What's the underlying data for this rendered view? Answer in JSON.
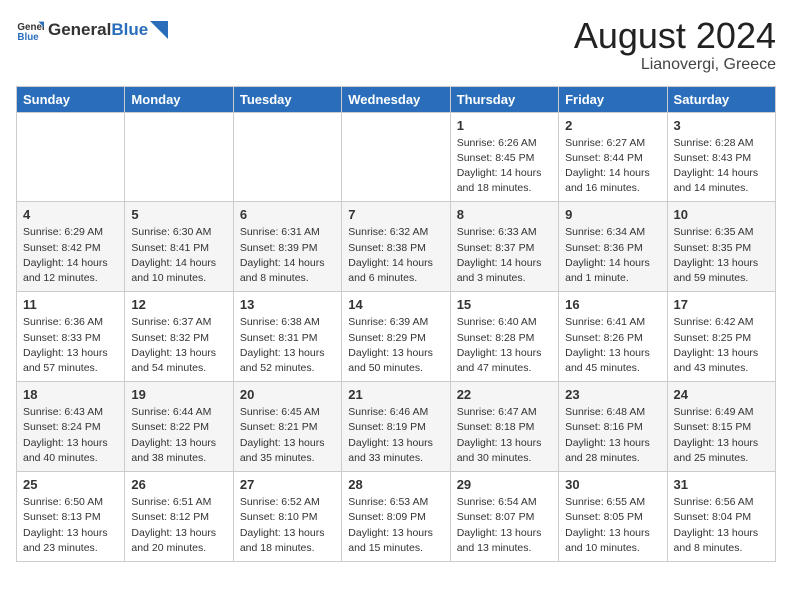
{
  "header": {
    "logo_general": "General",
    "logo_blue": "Blue",
    "month_year": "August 2024",
    "location": "Lianovergi, Greece"
  },
  "weekdays": [
    "Sunday",
    "Monday",
    "Tuesday",
    "Wednesday",
    "Thursday",
    "Friday",
    "Saturday"
  ],
  "weeks": [
    [
      {
        "day": "",
        "content": ""
      },
      {
        "day": "",
        "content": ""
      },
      {
        "day": "",
        "content": ""
      },
      {
        "day": "",
        "content": ""
      },
      {
        "day": "1",
        "content": "Sunrise: 6:26 AM\nSunset: 8:45 PM\nDaylight: 14 hours\nand 18 minutes."
      },
      {
        "day": "2",
        "content": "Sunrise: 6:27 AM\nSunset: 8:44 PM\nDaylight: 14 hours\nand 16 minutes."
      },
      {
        "day": "3",
        "content": "Sunrise: 6:28 AM\nSunset: 8:43 PM\nDaylight: 14 hours\nand 14 minutes."
      }
    ],
    [
      {
        "day": "4",
        "content": "Sunrise: 6:29 AM\nSunset: 8:42 PM\nDaylight: 14 hours\nand 12 minutes."
      },
      {
        "day": "5",
        "content": "Sunrise: 6:30 AM\nSunset: 8:41 PM\nDaylight: 14 hours\nand 10 minutes."
      },
      {
        "day": "6",
        "content": "Sunrise: 6:31 AM\nSunset: 8:39 PM\nDaylight: 14 hours\nand 8 minutes."
      },
      {
        "day": "7",
        "content": "Sunrise: 6:32 AM\nSunset: 8:38 PM\nDaylight: 14 hours\nand 6 minutes."
      },
      {
        "day": "8",
        "content": "Sunrise: 6:33 AM\nSunset: 8:37 PM\nDaylight: 14 hours\nand 3 minutes."
      },
      {
        "day": "9",
        "content": "Sunrise: 6:34 AM\nSunset: 8:36 PM\nDaylight: 14 hours\nand 1 minute."
      },
      {
        "day": "10",
        "content": "Sunrise: 6:35 AM\nSunset: 8:35 PM\nDaylight: 13 hours\nand 59 minutes."
      }
    ],
    [
      {
        "day": "11",
        "content": "Sunrise: 6:36 AM\nSunset: 8:33 PM\nDaylight: 13 hours\nand 57 minutes."
      },
      {
        "day": "12",
        "content": "Sunrise: 6:37 AM\nSunset: 8:32 PM\nDaylight: 13 hours\nand 54 minutes."
      },
      {
        "day": "13",
        "content": "Sunrise: 6:38 AM\nSunset: 8:31 PM\nDaylight: 13 hours\nand 52 minutes."
      },
      {
        "day": "14",
        "content": "Sunrise: 6:39 AM\nSunset: 8:29 PM\nDaylight: 13 hours\nand 50 minutes."
      },
      {
        "day": "15",
        "content": "Sunrise: 6:40 AM\nSunset: 8:28 PM\nDaylight: 13 hours\nand 47 minutes."
      },
      {
        "day": "16",
        "content": "Sunrise: 6:41 AM\nSunset: 8:26 PM\nDaylight: 13 hours\nand 45 minutes."
      },
      {
        "day": "17",
        "content": "Sunrise: 6:42 AM\nSunset: 8:25 PM\nDaylight: 13 hours\nand 43 minutes."
      }
    ],
    [
      {
        "day": "18",
        "content": "Sunrise: 6:43 AM\nSunset: 8:24 PM\nDaylight: 13 hours\nand 40 minutes."
      },
      {
        "day": "19",
        "content": "Sunrise: 6:44 AM\nSunset: 8:22 PM\nDaylight: 13 hours\nand 38 minutes."
      },
      {
        "day": "20",
        "content": "Sunrise: 6:45 AM\nSunset: 8:21 PM\nDaylight: 13 hours\nand 35 minutes."
      },
      {
        "day": "21",
        "content": "Sunrise: 6:46 AM\nSunset: 8:19 PM\nDaylight: 13 hours\nand 33 minutes."
      },
      {
        "day": "22",
        "content": "Sunrise: 6:47 AM\nSunset: 8:18 PM\nDaylight: 13 hours\nand 30 minutes."
      },
      {
        "day": "23",
        "content": "Sunrise: 6:48 AM\nSunset: 8:16 PM\nDaylight: 13 hours\nand 28 minutes."
      },
      {
        "day": "24",
        "content": "Sunrise: 6:49 AM\nSunset: 8:15 PM\nDaylight: 13 hours\nand 25 minutes."
      }
    ],
    [
      {
        "day": "25",
        "content": "Sunrise: 6:50 AM\nSunset: 8:13 PM\nDaylight: 13 hours\nand 23 minutes."
      },
      {
        "day": "26",
        "content": "Sunrise: 6:51 AM\nSunset: 8:12 PM\nDaylight: 13 hours\nand 20 minutes."
      },
      {
        "day": "27",
        "content": "Sunrise: 6:52 AM\nSunset: 8:10 PM\nDaylight: 13 hours\nand 18 minutes."
      },
      {
        "day": "28",
        "content": "Sunrise: 6:53 AM\nSunset: 8:09 PM\nDaylight: 13 hours\nand 15 minutes."
      },
      {
        "day": "29",
        "content": "Sunrise: 6:54 AM\nSunset: 8:07 PM\nDaylight: 13 hours\nand 13 minutes."
      },
      {
        "day": "30",
        "content": "Sunrise: 6:55 AM\nSunset: 8:05 PM\nDaylight: 13 hours\nand 10 minutes."
      },
      {
        "day": "31",
        "content": "Sunrise: 6:56 AM\nSunset: 8:04 PM\nDaylight: 13 hours\nand 8 minutes."
      }
    ]
  ]
}
